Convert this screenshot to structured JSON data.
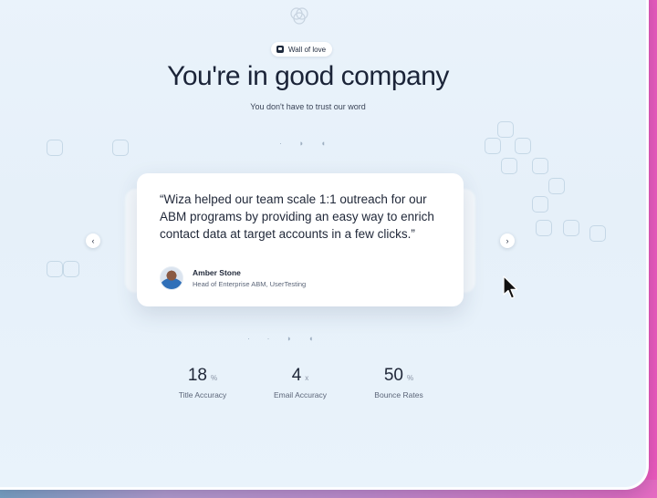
{
  "tag": {
    "label": "Wall of love"
  },
  "headline": "You're in good company",
  "subheadline": "You don't have to trust our word",
  "testimonial": {
    "quote": "“Wiza helped our team scale 1:1 outreach for our ABM programs by providing an easy way to enrich contact data at target accounts in a few clicks.”",
    "author_name": "Amber Stone",
    "author_role": "Head of Enterprise ABM, UserTesting"
  },
  "carousel": {
    "prev_icon": "‹",
    "next_icon": "›"
  },
  "stats": [
    {
      "value": "18",
      "unit": "%",
      "label": "Title Accuracy"
    },
    {
      "value": "4",
      "unit": "x",
      "label": "Email Accuracy"
    },
    {
      "value": "50",
      "unit": "%",
      "label": "Bounce Rates"
    }
  ],
  "colors": {
    "text_dark": "#1b2438",
    "background": "#e6f0f9",
    "backdrop_pink": "#ea5ec0"
  }
}
